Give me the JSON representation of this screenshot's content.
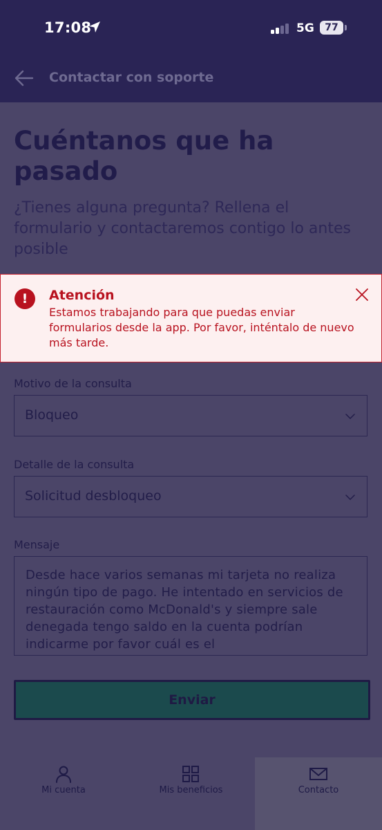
{
  "status_bar": {
    "time": "17:08",
    "network": "5G",
    "battery": "77"
  },
  "header": {
    "title": "Contactar con soporte"
  },
  "main": {
    "heading": "Cuéntanos que ha pasado",
    "subheading": "¿Tienes alguna pregunta? Rellena el formulario y contactaremos contigo lo antes posible"
  },
  "alert": {
    "title": "Atención",
    "message": "Estamos trabajando para que puedas enviar formularios desde la app. Por favor, inténtalo de nuevo más tarde.",
    "icon_glyph": "!",
    "color": "#b8121f"
  },
  "form": {
    "reason": {
      "label": "Motivo de la consulta",
      "value": "Bloqueo"
    },
    "detail": {
      "label": "Detalle de la consulta",
      "value": "Solicitud desbloqueo"
    },
    "message": {
      "label": "Mensaje",
      "value": "Desde hace varios semanas mi tarjeta no realiza ningún tipo de pago. He intentado en servicios de restauración como McDonald's y siempre sale denegada tengo saldo en la cuenta podrían indicarme por favor cuál es el"
    },
    "submit_label": "Enviar"
  },
  "bottom_nav": {
    "items": [
      {
        "label": "Mi cuenta",
        "icon": "user-icon"
      },
      {
        "label": "Mis beneficios",
        "icon": "grid-icon"
      },
      {
        "label": "Contacto",
        "icon": "mail-icon",
        "active": true
      }
    ]
  },
  "colors": {
    "header_bg": "#2a2455",
    "content_bg": "#4b4568",
    "accent_button": "#1b4a4d",
    "alert_red": "#b8121f"
  }
}
